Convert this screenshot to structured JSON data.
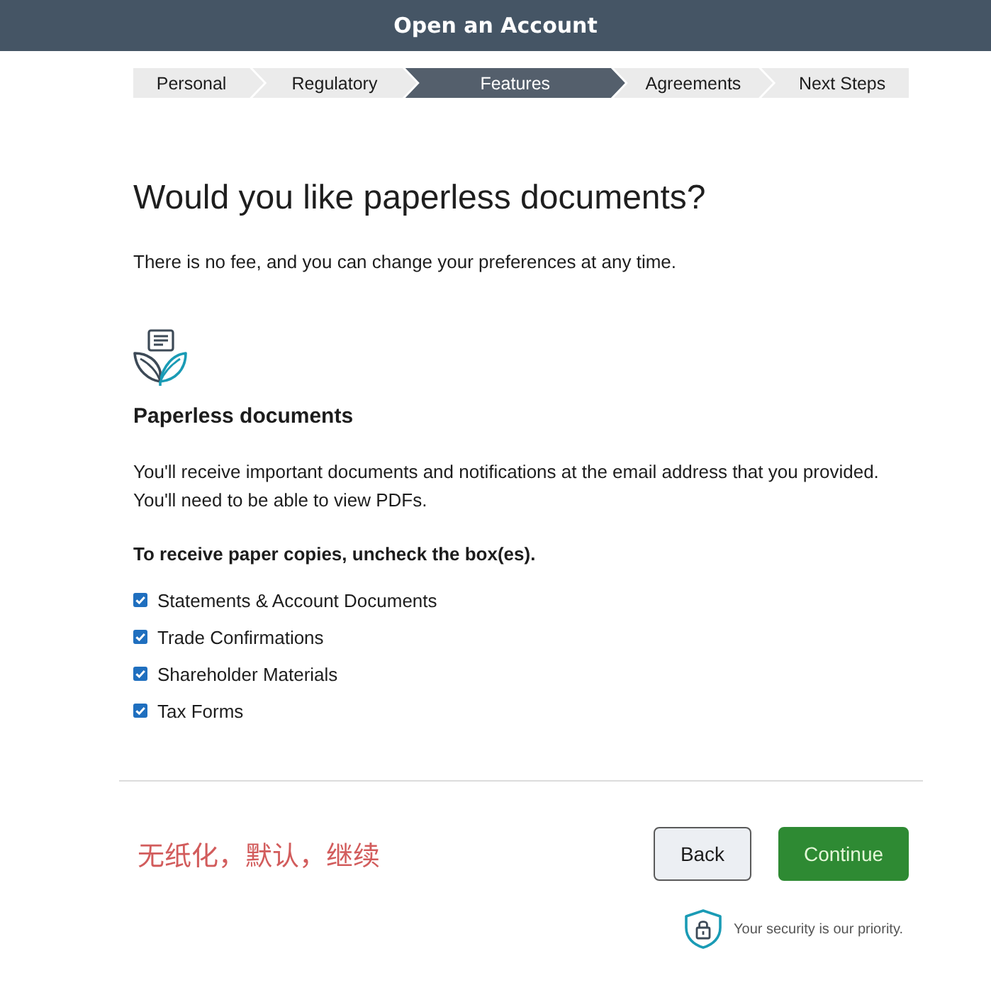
{
  "window": {
    "title": "Open an Account"
  },
  "steps": [
    {
      "label": "Personal",
      "selected": false
    },
    {
      "label": "Regulatory",
      "selected": false
    },
    {
      "label": "Features",
      "selected": true
    },
    {
      "label": "Agreements",
      "selected": false
    },
    {
      "label": "Next Steps",
      "selected": false
    }
  ],
  "heading": "Would you like paperless documents?",
  "subtitle": "There is no fee, and you can change your preferences at any time.",
  "feature": {
    "title": "Paperless documents",
    "description": "You'll receive important documents and notifications at the email address that you provided. You'll need to be able to view PDFs."
  },
  "instruction": "To receive paper copies, uncheck the box(es).",
  "options": [
    {
      "label": "Statements & Account Documents",
      "checked": true
    },
    {
      "label": "Trade Confirmations",
      "checked": true
    },
    {
      "label": "Shareholder Materials",
      "checked": true
    },
    {
      "label": "Tax Forms",
      "checked": true
    }
  ],
  "annotation": "无纸化，默认，继续",
  "buttons": [
    {
      "label": "Back",
      "kind": "secondary"
    },
    {
      "label": "Continue",
      "kind": "primary"
    }
  ],
  "security_note": "Your security is our priority."
}
